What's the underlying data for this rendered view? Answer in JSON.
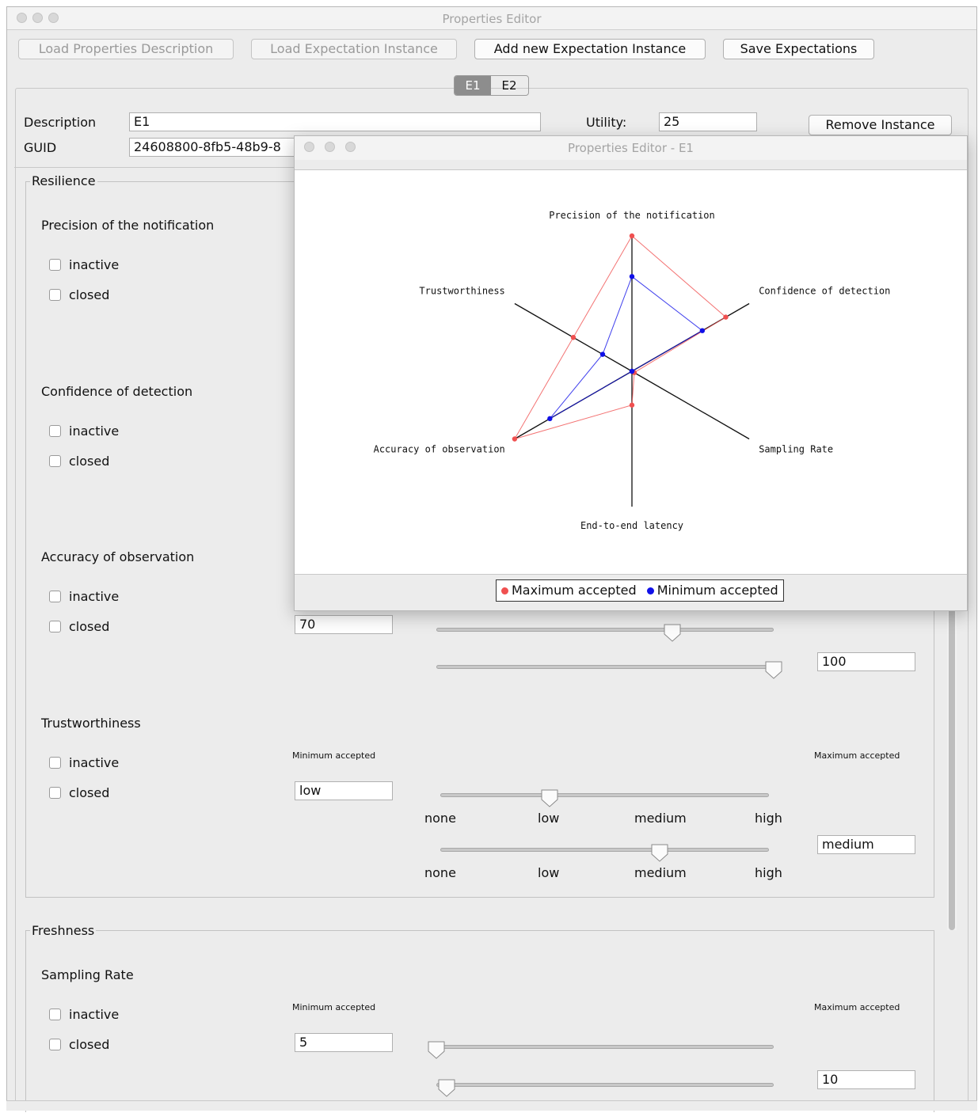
{
  "window": {
    "title": "Properties Editor"
  },
  "toolbar": {
    "load_description": "Load Properties Description",
    "load_instance": "Load Expectation Instance",
    "add_instance": "Add new Expectation Instance",
    "save": "Save Expectations"
  },
  "tabs": [
    {
      "label": "E1",
      "selected": true
    },
    {
      "label": "E2",
      "selected": false
    }
  ],
  "instance": {
    "description_label": "Description",
    "description_value": "E1",
    "utility_label": "Utility:",
    "utility_value": "25",
    "remove_label": "Remove Instance",
    "guid_label": "GUID",
    "guid_value": "24608800-8fb5-48b9-8"
  },
  "form": {
    "inactive_label": "inactive",
    "closed_label": "closed",
    "min_label": "Minimum accepted",
    "max_label": "Maximum accepted"
  },
  "resilience": {
    "title": "Resilience",
    "precision": {
      "title": "Precision of the notification"
    },
    "confidence": {
      "title": "Confidence of detection"
    },
    "accuracy": {
      "title": "Accuracy of observation",
      "min_value": "70",
      "max_value": "100",
      "min_slider": 0.7,
      "max_slider": 1.0
    },
    "trust": {
      "title": "Trustworthiness",
      "min_value": "low",
      "max_value": "medium",
      "scale": [
        "none",
        "low",
        "medium",
        "high"
      ],
      "min_slider": 0.333,
      "max_slider": 0.667
    }
  },
  "freshness": {
    "title": "Freshness",
    "sampling": {
      "title": "Sampling Rate",
      "min_value": "5",
      "max_value": "10",
      "min_slider": 0.0,
      "max_slider": 0.03
    }
  },
  "popup": {
    "title": "Properties Editor - E1",
    "legend_max": "Maximum accepted",
    "legend_min": "Minimum accepted"
  },
  "colors": {
    "max_series": "#f05050",
    "min_series": "#1010e8"
  },
  "chart_data": {
    "type": "radar",
    "axes": [
      "Precision of the notification",
      "Confidence of detection",
      "Sampling Rate",
      "End-to-end latency",
      "Accuracy of observation",
      "Trustworthiness"
    ],
    "range": [
      0,
      1
    ],
    "series": [
      {
        "name": "Maximum accepted",
        "color": "#f05050",
        "values": [
          1.0,
          0.8,
          0.02,
          0.25,
          1.0,
          0.5
        ]
      },
      {
        "name": "Minimum accepted",
        "color": "#1010e8",
        "values": [
          0.7,
          0.6,
          0.0,
          0.0,
          0.7,
          0.25
        ]
      }
    ]
  }
}
